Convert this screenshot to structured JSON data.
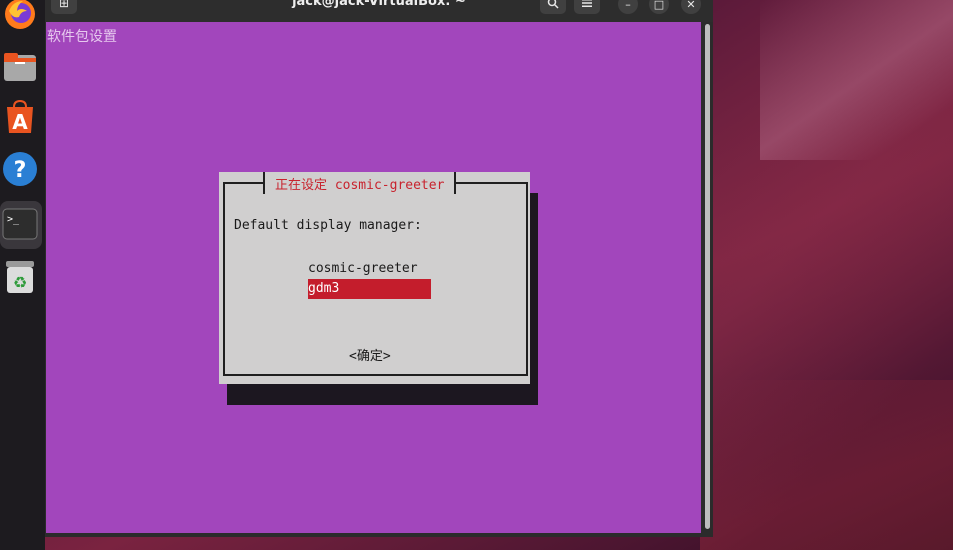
{
  "window": {
    "title": "jack@jack-VirtualBox: ~",
    "new_tab_glyph": "+",
    "buttons": [
      "search-icon",
      "menu-icon",
      "minimize-icon",
      "maximize-icon",
      "close-icon"
    ]
  },
  "dock": {
    "items": [
      "firefox-icon",
      "files-icon",
      "app-center-icon",
      "help-icon",
      "terminal-icon",
      "trash-icon"
    ]
  },
  "terminal": {
    "header": "软件包设置"
  },
  "dialog": {
    "title": "正在设定 cosmic-greeter",
    "prompt": "Default display manager:",
    "options": [
      {
        "label": "cosmic-greeter",
        "selected": false
      },
      {
        "label": "gdm3",
        "selected": true
      }
    ],
    "ok_label": "<确定>"
  },
  "colors": {
    "terminal_bg": "#a246bc",
    "dialog_bg": "#d0cfcf",
    "title_accent": "#c8232e",
    "selection": "#c41d2c"
  }
}
